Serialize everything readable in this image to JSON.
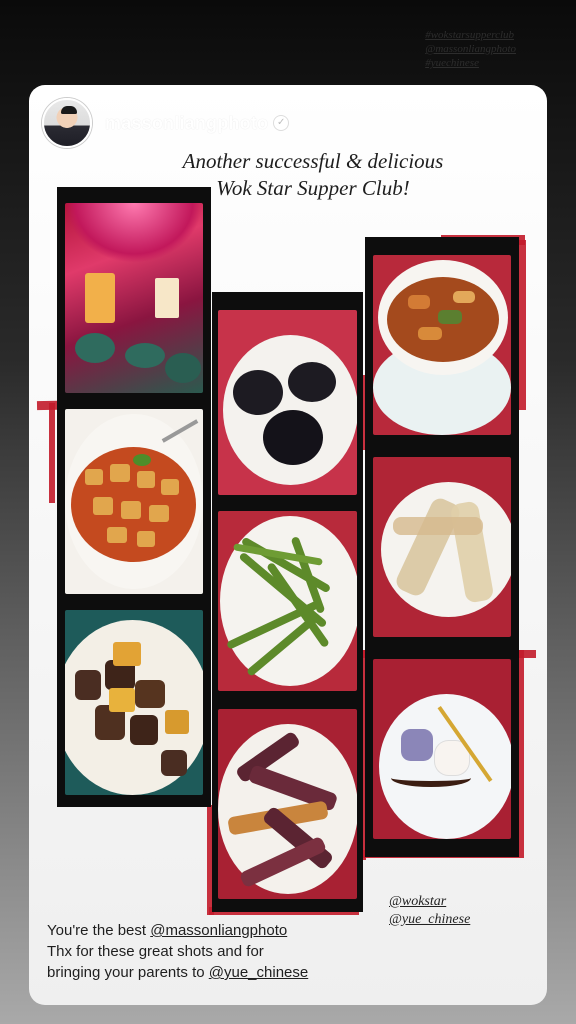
{
  "background_tags": [
    "#wokstarsupperclub",
    "@massonliangphoto",
    "#yuechinese"
  ],
  "post": {
    "username": "massonliangphoto",
    "verified_icon": "verified-badge-icon",
    "headline_line1": "Another successful & delicious",
    "headline_line2": "Wok Star Supper Club!"
  },
  "photos": [
    {
      "name": "restaurant-interior-photo",
      "description_icon": "dining-room"
    },
    {
      "name": "mapo-tofu-photo",
      "description_icon": "tofu-dish"
    },
    {
      "name": "beef-potato-photo",
      "description_icon": "beef-dish"
    },
    {
      "name": "black-dumplings-photo",
      "description_icon": "dumplings"
    },
    {
      "name": "green-beans-photo",
      "description_icon": "beans"
    },
    {
      "name": "eggplant-photo",
      "description_icon": "eggplant"
    },
    {
      "name": "stir-fry-bowl-photo",
      "description_icon": "stir-fry"
    },
    {
      "name": "spring-rolls-photo",
      "description_icon": "rolls"
    },
    {
      "name": "dessert-photo",
      "description_icon": "dessert"
    }
  ],
  "mentions": {
    "tag1": "@wokstar",
    "tag2": "@yue_chinese"
  },
  "caption": {
    "line1_text": "You're the best ",
    "line1_mention": "@massonliangphoto",
    "line2": "Thx for these great shots and for",
    "line3_text": "bringing your parents to ",
    "line3_mention": "@yue_chinese"
  },
  "colors": {
    "accent_red": "#c21b2a",
    "film_black": "#0d0d0d"
  }
}
